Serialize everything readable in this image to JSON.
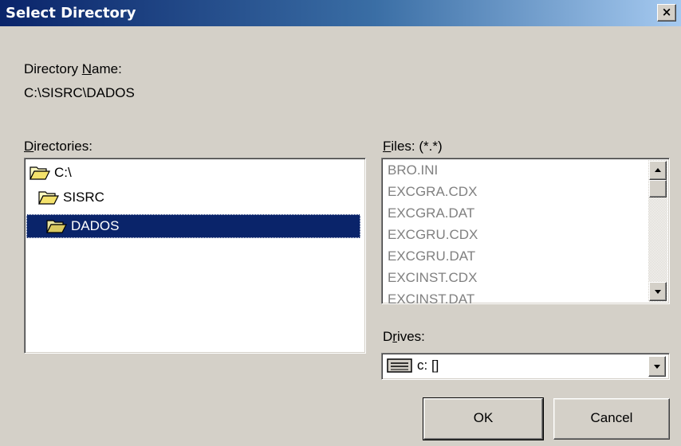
{
  "window": {
    "title": "Select Directory",
    "close_label": "×"
  },
  "directory_name": {
    "label_pre": "Directory ",
    "label_accel": "N",
    "label_post": "ame:",
    "value": "C:\\SISRC\\DADOS"
  },
  "directories": {
    "label_accel": "D",
    "label_post": "irectories:",
    "items": [
      {
        "label": "C:\\",
        "state": "open"
      },
      {
        "label": "SISRC",
        "state": "open"
      },
      {
        "label": "DADOS",
        "state": "open-selected"
      }
    ]
  },
  "files": {
    "label_accel": "F",
    "label_post": "iles: (*.*)",
    "items": [
      "BRO.INI",
      "EXCGRA.CDX",
      "EXCGRA.DAT",
      "EXCGRU.CDX",
      "EXCGRU.DAT",
      "EXCINST.CDX",
      "EXCINST.DAT"
    ]
  },
  "drives": {
    "label_pre": "D",
    "label_accel": "r",
    "label_post": "ives:",
    "selected": "c: []"
  },
  "buttons": {
    "ok": "OK",
    "cancel": "Cancel"
  },
  "colors": {
    "title_start": "#0a246a",
    "title_end": "#a6caf0",
    "selection": "#0a246a",
    "face": "#d4d0c8"
  }
}
